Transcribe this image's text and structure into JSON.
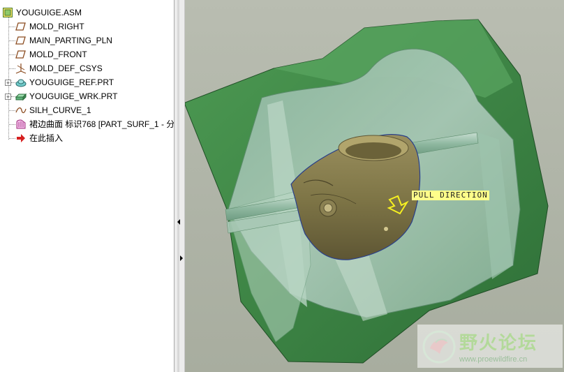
{
  "model_tree": {
    "root_label": "YOUGUIGE.ASM",
    "items": [
      {
        "label": "MOLD_RIGHT",
        "icon": "datum-plane-icon"
      },
      {
        "label": "MAIN_PARTING_PLN",
        "icon": "datum-plane-icon"
      },
      {
        "label": "MOLD_FRONT",
        "icon": "datum-plane-icon"
      },
      {
        "label": "MOLD_DEF_CSYS",
        "icon": "coordinate-system-icon"
      },
      {
        "label": "YOUGUIGE_REF.PRT",
        "icon": "part-icon"
      },
      {
        "label": "YOUGUIGE_WRK.PRT",
        "icon": "workpiece-icon"
      },
      {
        "label": "SILH_CURVE_1",
        "icon": "curve-icon"
      },
      {
        "label": "裙边曲面 标识768 [PART_SURF_1 - 分",
        "icon": "surface-icon"
      },
      {
        "label": "在此插入",
        "icon": "insert-here-arrow-icon"
      }
    ]
  },
  "viewport": {
    "pull_direction_label": "PULL DIRECTION"
  },
  "watermark": {
    "title": "野火论坛",
    "url": "www.proewildfire.cn"
  },
  "colors": {
    "workpiece_green": "#3f8a45",
    "part_olive": "#7d7448",
    "label_yellow": "#fffe8a"
  }
}
